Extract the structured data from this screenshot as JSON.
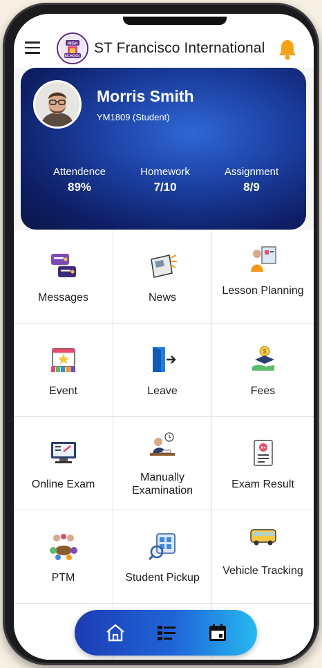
{
  "header": {
    "app_title": "ST Francisco International",
    "logo_text_top": "HIGH",
    "logo_text_bottom": "SCHOOL"
  },
  "profile": {
    "name": "Morris Smith",
    "id_line": "YM1809 (Student)",
    "stats": [
      {
        "label": "Attendence",
        "value": "89%"
      },
      {
        "label": "Homework",
        "value": "7/10"
      },
      {
        "label": "Assignment",
        "value": "8/9"
      }
    ]
  },
  "menu": [
    {
      "label": "Messages",
      "icon": "messages-icon"
    },
    {
      "label": "News",
      "icon": "news-icon"
    },
    {
      "label": "Lesson Planning",
      "icon": "lesson-planning-icon"
    },
    {
      "label": "Event",
      "icon": "event-icon"
    },
    {
      "label": "Leave",
      "icon": "leave-icon"
    },
    {
      "label": "Fees",
      "icon": "fees-icon"
    },
    {
      "label": "Online Exam",
      "icon": "online-exam-icon"
    },
    {
      "label": "Manually Examination",
      "icon": "manual-examination-icon"
    },
    {
      "label": "Exam Result",
      "icon": "exam-result-icon"
    },
    {
      "label": "PTM",
      "icon": "ptm-icon"
    },
    {
      "label": "Student Pickup",
      "icon": "student-pickup-icon"
    },
    {
      "label": "Vehicle Tracking",
      "icon": "vehicle-tracking-icon"
    }
  ],
  "bottom_nav": {
    "items": [
      "home-icon",
      "list-icon",
      "calendar-icon"
    ]
  },
  "colors": {
    "card_dark": "#0e1f66",
    "card_light": "#2f67d6",
    "nav_start": "#1c3cb4",
    "nav_end": "#27b9f0",
    "bell": "#f7a31a"
  }
}
